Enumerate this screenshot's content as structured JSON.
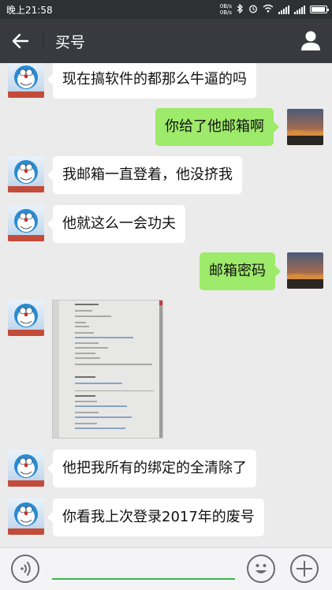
{
  "status_bar": {
    "time": "晚上21:58",
    "net_up": "0B/s",
    "net_down": "0B/s",
    "icons": [
      "bluetooth-icon",
      "alarm-icon",
      "wifi-icon",
      "signal-icon",
      "signal-icon",
      "battery-icon"
    ]
  },
  "header": {
    "title": "买号",
    "back_icon": "arrow-left-icon",
    "profile_icon": "person-icon"
  },
  "messages": [
    {
      "side": "left",
      "type": "text",
      "text": "现在搞软件的都那么牛逼的吗",
      "avatar": "doraemon-avatar"
    },
    {
      "side": "right",
      "type": "text",
      "text": "你给了他邮箱啊",
      "avatar": "sunset-avatar"
    },
    {
      "side": "left",
      "type": "text",
      "text": "我邮箱一直登着，他没挤我",
      "avatar": "doraemon-avatar"
    },
    {
      "side": "left",
      "type": "text",
      "text": "他就这么一会功夫",
      "avatar": "doraemon-avatar"
    },
    {
      "side": "right",
      "type": "text",
      "text": "邮箱密码",
      "avatar": "sunset-avatar"
    },
    {
      "side": "left",
      "type": "image",
      "text": "",
      "avatar": "doraemon-avatar"
    },
    {
      "side": "left",
      "type": "text",
      "text": "他把我所有的绑定的全清除了",
      "avatar": "doraemon-avatar"
    },
    {
      "side": "left",
      "type": "text",
      "text": "你看我上次登录2017年的废号",
      "avatar": "doraemon-avatar"
    }
  ],
  "input_bar": {
    "voice_icon": "voice-icon",
    "emoji_icon": "emoji-icon",
    "plus_icon": "plus-icon",
    "input_value": ""
  },
  "colors": {
    "status_bar": "#2e3132",
    "title_bar": "#393a3f",
    "chat_background": "#ebebeb",
    "sent_bubble": "#9eea6a",
    "received_bubble": "#ffffff",
    "input_underline": "#3bb54a"
  }
}
